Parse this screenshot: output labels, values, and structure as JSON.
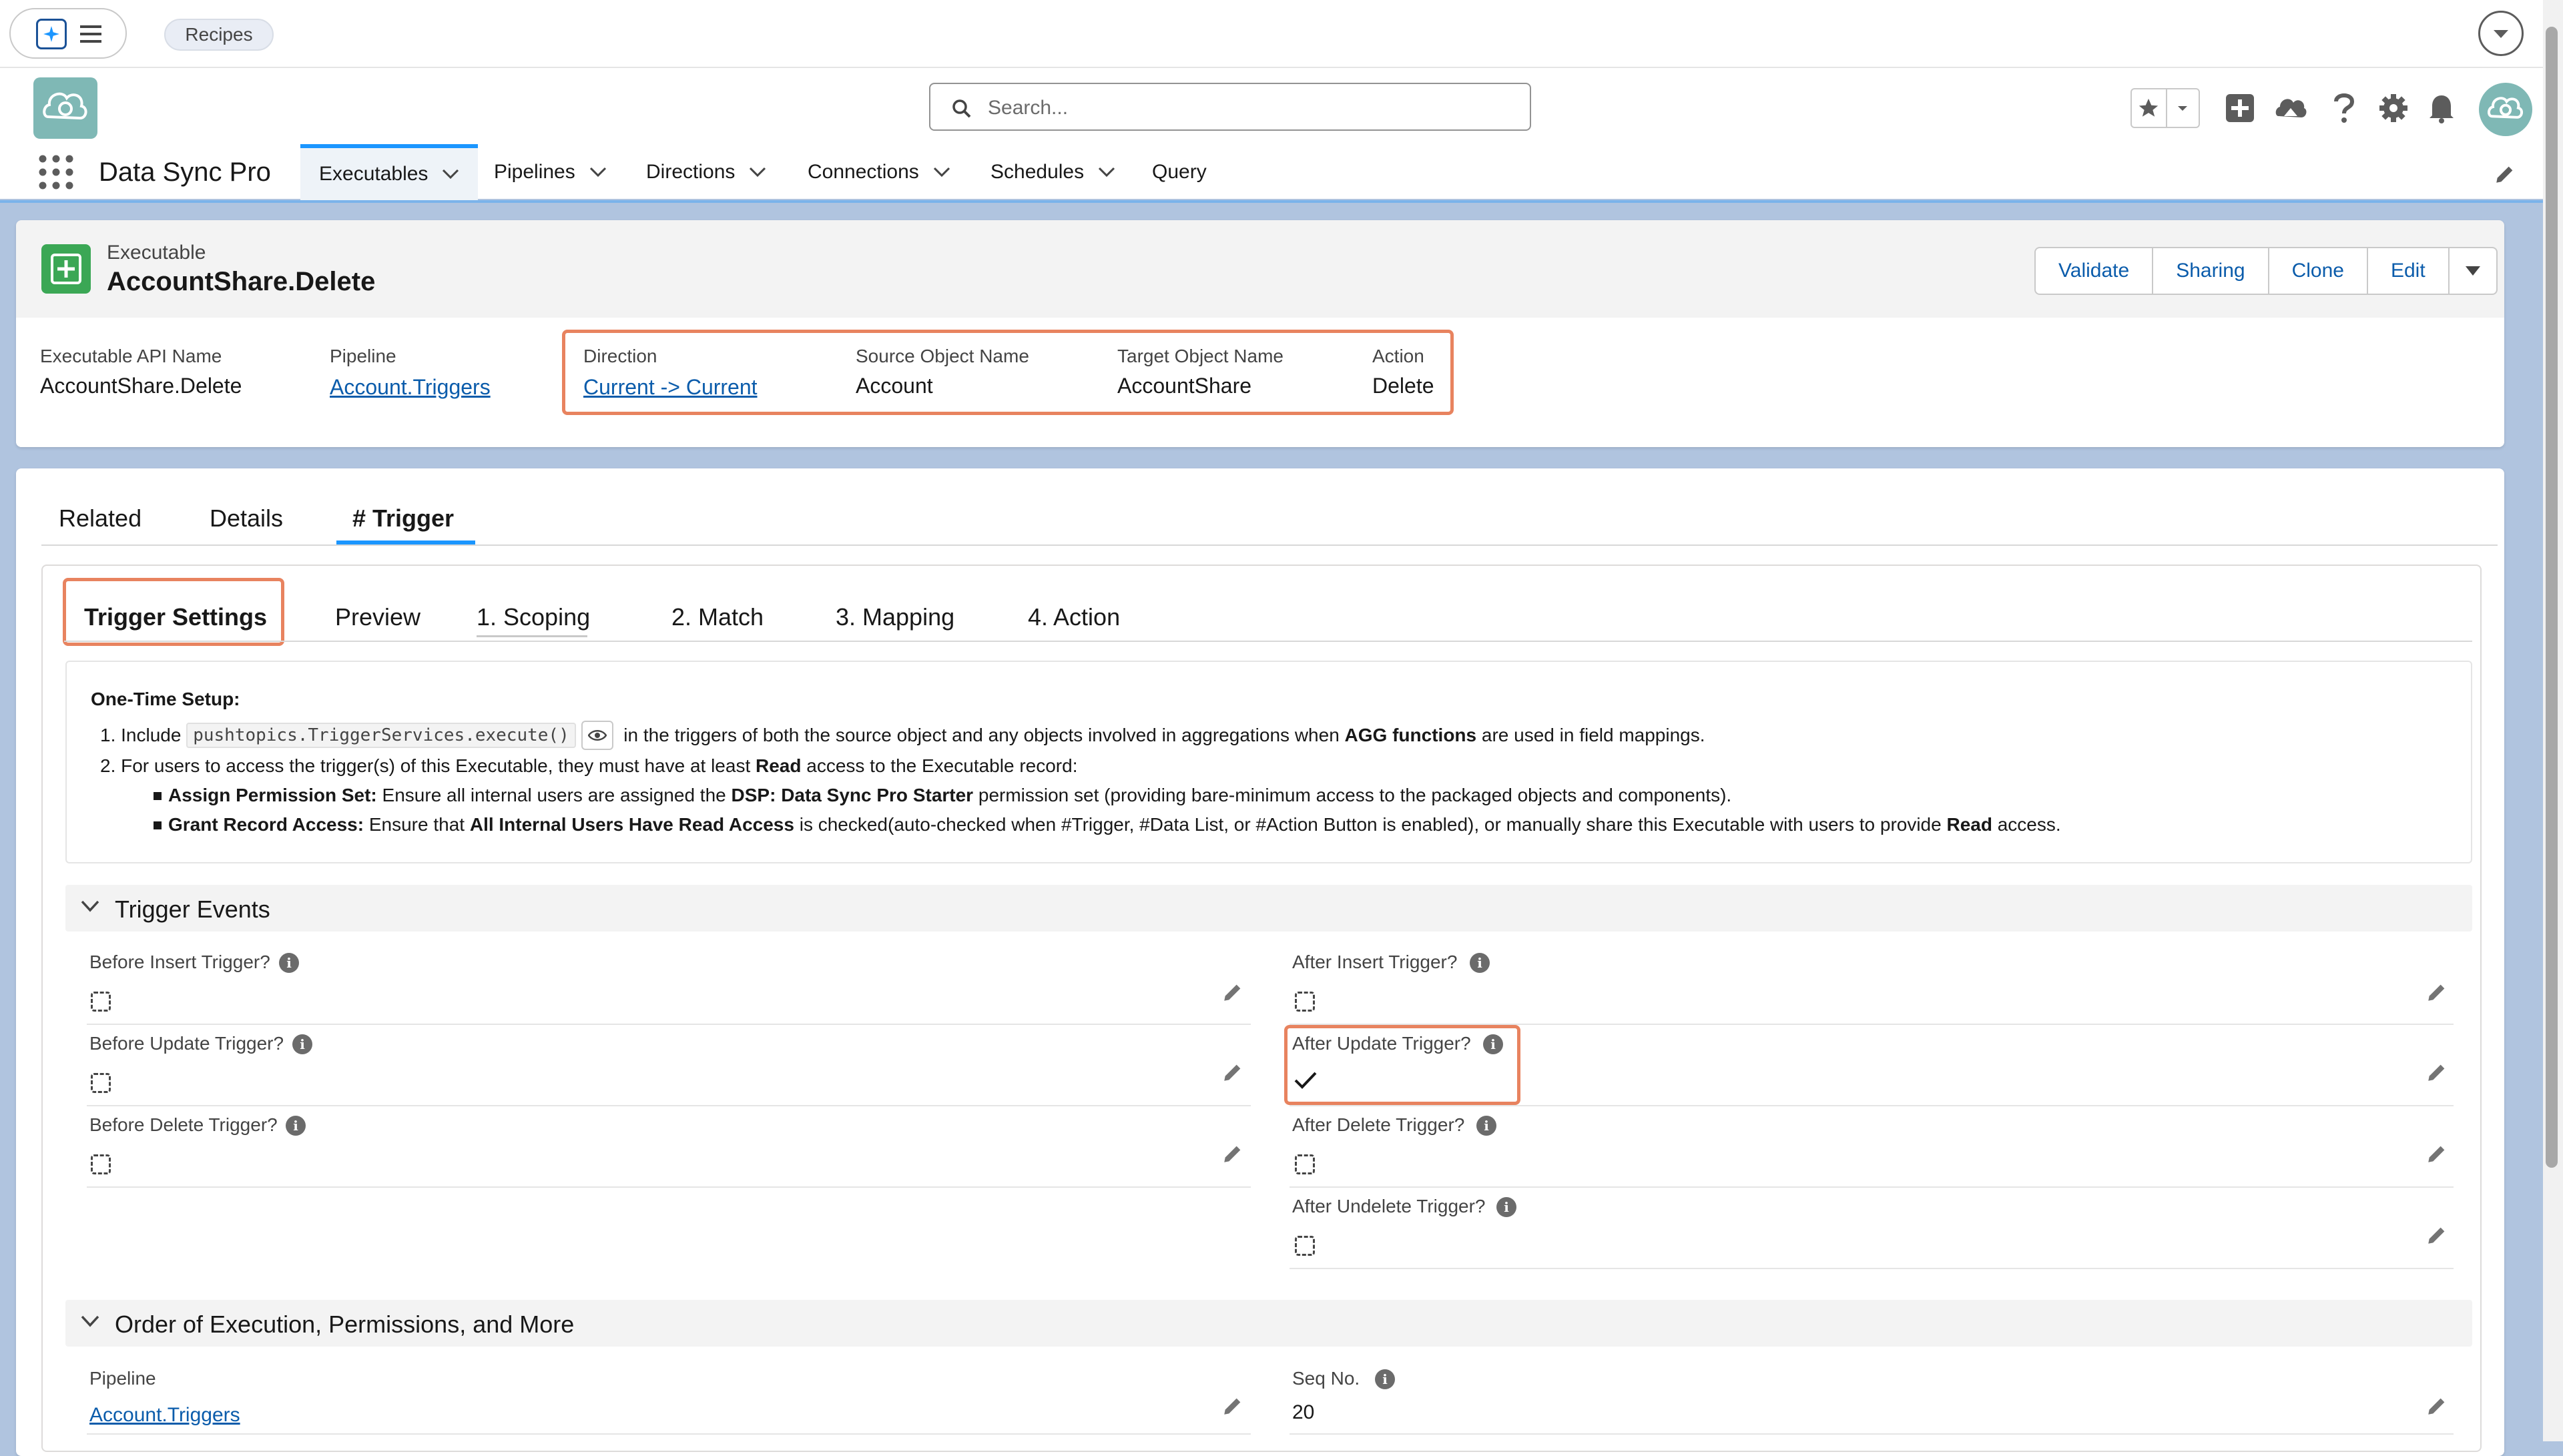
{
  "strip": {
    "recipes_label": "Recipes"
  },
  "header": {
    "search_placeholder": "Search..."
  },
  "app": {
    "name": "Data Sync Pro"
  },
  "nav": {
    "tabs": [
      {
        "label": "Executables",
        "has_menu": true,
        "active": true
      },
      {
        "label": "Pipelines",
        "has_menu": true
      },
      {
        "label": "Directions",
        "has_menu": true
      },
      {
        "label": "Connections",
        "has_menu": true
      },
      {
        "label": "Schedules",
        "has_menu": true
      },
      {
        "label": "Query",
        "has_menu": false
      }
    ]
  },
  "record": {
    "type": "Executable",
    "title": "AccountShare.Delete",
    "actions": [
      "Validate",
      "Sharing",
      "Clone",
      "Edit"
    ],
    "fields": {
      "api_name": {
        "label": "Executable API Name",
        "value": "AccountShare.Delete"
      },
      "pipeline": {
        "label": "Pipeline",
        "value": "Account.Triggers"
      },
      "direction": {
        "label": "Direction",
        "value": "Current -> Current"
      },
      "source": {
        "label": "Source Object Name",
        "value": "Account"
      },
      "target": {
        "label": "Target Object Name",
        "value": "AccountShare"
      },
      "action": {
        "label": "Action",
        "value": "Delete"
      }
    }
  },
  "tabs": [
    "Related",
    "Details",
    "# Trigger"
  ],
  "subtabs": [
    "Trigger Settings",
    "Preview",
    "1. Scoping",
    "2. Match",
    "3. Mapping",
    "4. Action"
  ],
  "setup": {
    "title": "One-Time Setup:",
    "l1_prefix": "1. Include",
    "l1_code": "pushtopics.TriggerServices.execute()",
    "l1_mid": "in the triggers of both the source object and any objects involved in aggregations when",
    "l1_bold": "AGG functions",
    "l1_end": "are used in field mappings.",
    "l2_prefix": "2. For users to access the trigger(s) of this Executable, they must have at least",
    "l2_bold": "Read",
    "l2_end": "access to the Executable record:",
    "b1_bold": "Assign Permission Set:",
    "b1_text": "Ensure all internal users are assigned the",
    "b1_bold2": "DSP: Data Sync Pro Starter",
    "b1_end": "permission set (providing bare-minimum access to the packaged objects and components).",
    "b2_bold": "Grant Record Access:",
    "b2_text": "Ensure that",
    "b2_bold2": "All Internal Users Have Read Access",
    "b2_mid": "is checked(auto-checked when #Trigger, #Data List, or #Action Button is enabled), or manually share this Executable with users to provide",
    "b2_bold3": "Read",
    "b2_end": "access."
  },
  "trigger_events": {
    "title": "Trigger Events",
    "before_insert": {
      "label": "Before Insert Trigger?",
      "checked": false
    },
    "before_update": {
      "label": "Before Update Trigger?",
      "checked": false
    },
    "before_delete": {
      "label": "Before Delete Trigger?",
      "checked": false
    },
    "after_insert": {
      "label": "After Insert Trigger?",
      "checked": false
    },
    "after_update": {
      "label": "After Update Trigger?",
      "checked": true
    },
    "after_delete": {
      "label": "After Delete Trigger?",
      "checked": false
    },
    "after_undelete": {
      "label": "After Undelete Trigger?",
      "checked": false
    }
  },
  "order": {
    "title": "Order of Execution, Permissions, and More",
    "pipeline": {
      "label": "Pipeline",
      "value": "Account.Triggers"
    },
    "seq": {
      "label": "Seq No.",
      "value": "20"
    }
  },
  "colors": {
    "brand_blue": "#1b96ff",
    "link": "#0b5cab",
    "highlight_orange": "#e8835f",
    "record_icon": "#3ba755",
    "app_avatar": "#7fb8b5"
  },
  "icons": [
    "app-launcher-icon",
    "menu-icon",
    "search-icon",
    "favorites-star-icon",
    "add-icon",
    "trailhead-icon",
    "help-icon",
    "setup-gear-icon",
    "notification-bell-icon",
    "waffle-icon",
    "pencil-icon",
    "info-icon",
    "chevron-down-icon",
    "eye-icon",
    "checkmark-icon"
  ]
}
